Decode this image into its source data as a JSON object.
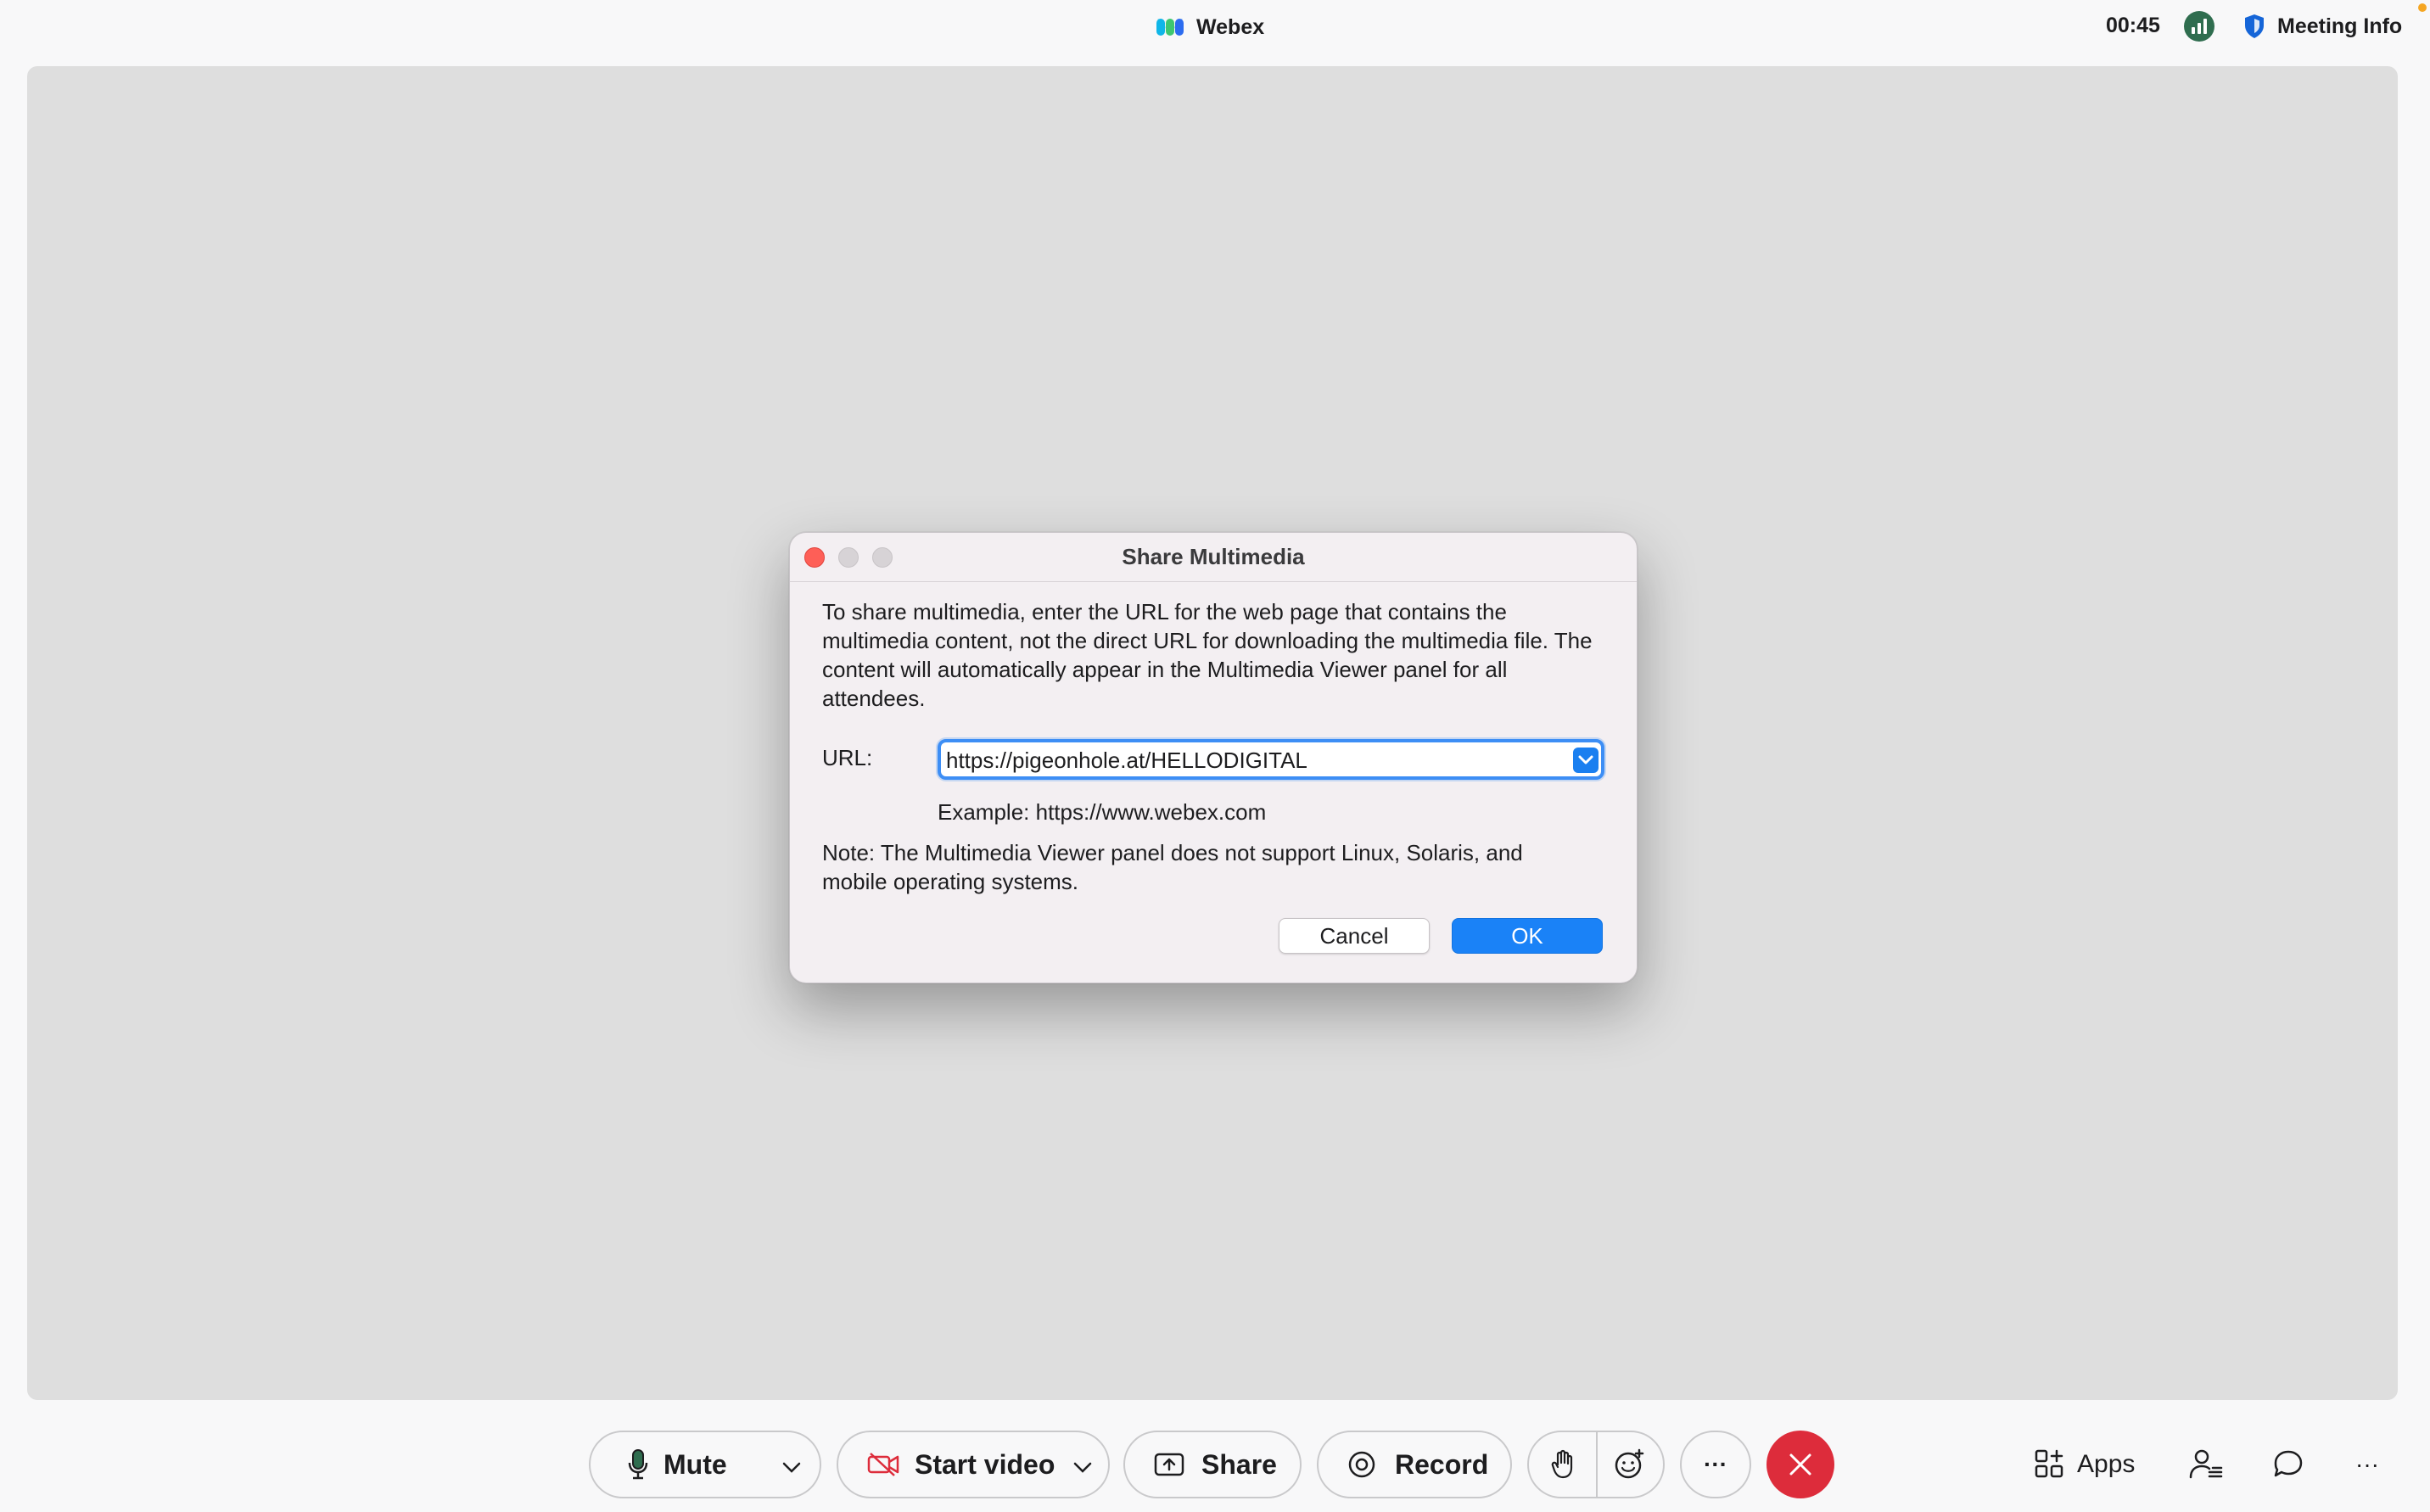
{
  "topbar": {
    "app_title": "Webex",
    "timer": "00:45",
    "meeting_info_label": "Meeting Info"
  },
  "dialog": {
    "title": "Share Multimedia",
    "description": "To share multimedia, enter the URL for the web page that contains the multimedia content, not the direct URL for downloading the multimedia file. The content will automatically appear in the Multimedia Viewer panel for all attendees.",
    "url_label": "URL:",
    "url_value": "https://pigeonhole.at/HELLODIGITAL",
    "example": "Example: https://www.webex.com",
    "note": "Note: The Multimedia Viewer panel does not support Linux, Solaris, and mobile operating systems.",
    "cancel_label": "Cancel",
    "ok_label": "OK"
  },
  "toolbar": {
    "mute_label": "Mute",
    "start_video_label": "Start video",
    "share_label": "Share",
    "record_label": "Record",
    "more_label": "···",
    "apps_label": "Apps"
  },
  "colors": {
    "accent": "#1a82f7",
    "end_call": "#dd2c3b",
    "video_off": "#dd2c3b",
    "stage": "#dedede"
  },
  "icons": [
    "webex-logo-icon",
    "stats-icon",
    "shield-icon",
    "microphone-icon",
    "chevron-down-icon",
    "video-off-icon",
    "share-screen-icon",
    "record-icon",
    "raise-hand-icon",
    "reaction-icon",
    "more-icon",
    "close-icon",
    "apps-icon",
    "participants-icon",
    "chat-icon"
  ]
}
